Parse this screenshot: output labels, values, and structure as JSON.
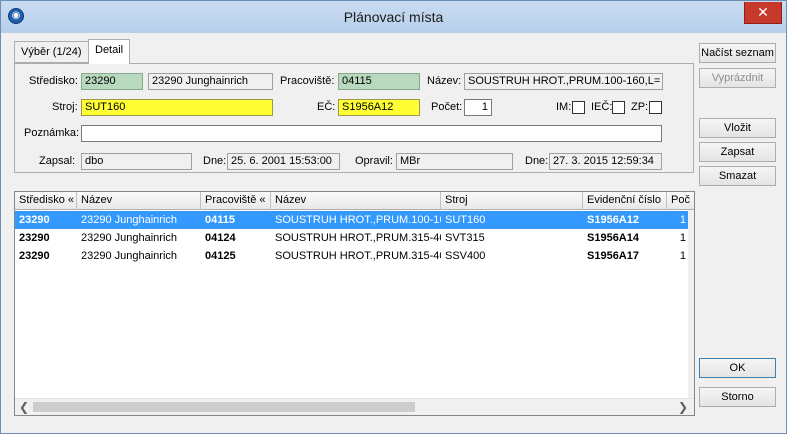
{
  "window": {
    "title": "Plánovací místa",
    "close_symbol": "✕"
  },
  "tabs": [
    {
      "label": "Výběr (1/24)"
    },
    {
      "label": "Detail"
    }
  ],
  "form": {
    "stredisko_label": "Středisko:",
    "stredisko_code": "23290",
    "stredisko_name": "23290 Junghainrich",
    "pracoviste_label": "Pracoviště:",
    "pracoviste_code": "04115",
    "nazev_label": "Název:",
    "nazev_value": "SOUSTRUH HROT.,PRUM.100-160,L=",
    "stroj_label": "Stroj:",
    "stroj_value": "SUT160",
    "ec_label": "EČ:",
    "ec_value": "S1956A12",
    "pocet_label": "Počet:",
    "pocet_value": "1",
    "im_label": "IM:",
    "iec_label": "IEČ:",
    "zp_label": "ZP:",
    "poznamka_label": "Poznámka:",
    "poznamka_value": "",
    "zapsal_label": "Zapsal:",
    "zapsal_value": "dbo",
    "dne1_label": "Dne:",
    "dne1_value": "25. 6. 2001 15:53:00",
    "opravil_label": "Opravil:",
    "opravil_value": "MBr",
    "dne2_label": "Dne:",
    "dne2_value": "27. 3. 2015 12:59:34"
  },
  "buttons": {
    "nacist": "Načíst seznam",
    "vyprazdnit": "Vyprázdnit",
    "vlozit": "Vložit",
    "zapsat": "Zapsat",
    "smazat": "Smazat",
    "ok": "OK",
    "storno": "Storno"
  },
  "grid": {
    "columns": [
      "Středisko «",
      "Název",
      "Pracoviště «",
      "Název",
      "Stroj",
      "Evidenční číslo",
      "Poč"
    ],
    "rows": [
      [
        "23290",
        "23290 Junghainrich",
        "04115",
        "SOUSTRUH HROT.,PRUM.100-16...",
        "SUT160",
        "S1956A12",
        "1"
      ],
      [
        "23290",
        "23290 Junghainrich",
        "04124",
        "SOUSTRUH HROT.,PRUM.315-40...",
        "SVT315",
        "S1956A14",
        "1"
      ],
      [
        "23290",
        "23290 Junghainrich",
        "04125",
        "SOUSTRUH HROT.,PRUM.315-40...",
        "SSV400",
        "S1956A17",
        "1"
      ]
    ],
    "scroll_left": "❮",
    "scroll_right": "❯"
  },
  "colors": {
    "selection": "#3399ff",
    "highlight_yellow": "#ffff33",
    "highlight_green": "#b8d9bd"
  }
}
